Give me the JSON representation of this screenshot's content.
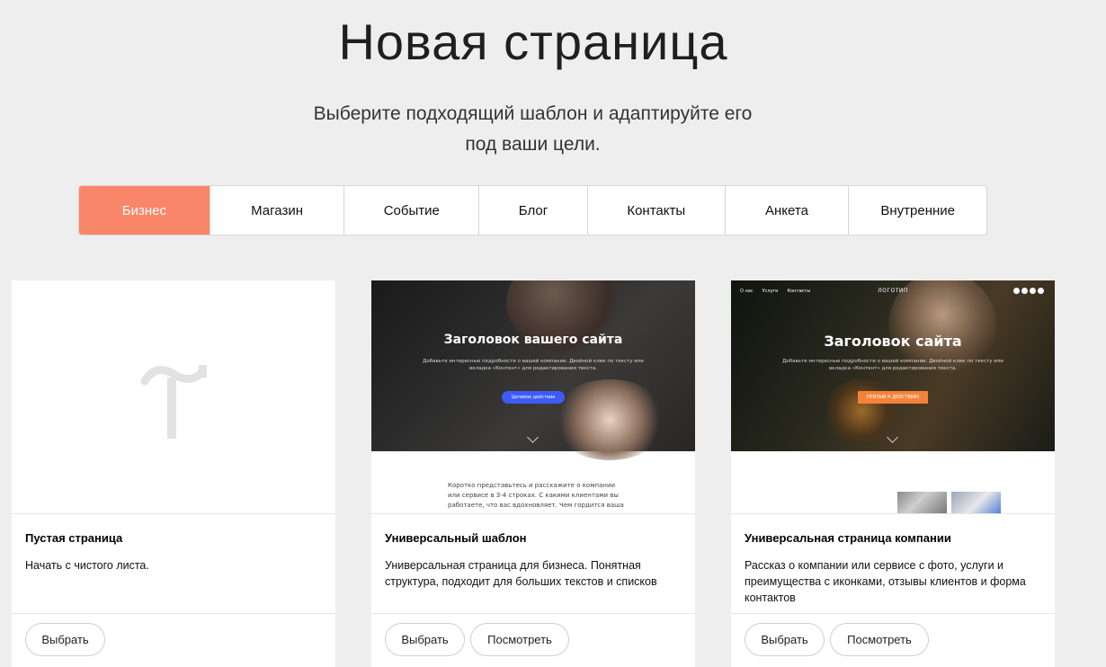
{
  "header": {
    "title": "Новая страница",
    "subtitle": "Выберите подходящий шаблон и адаптируйте его под ваши цели."
  },
  "tabs": [
    {
      "label": "Бизнес",
      "active": true
    },
    {
      "label": "Магазин",
      "active": false
    },
    {
      "label": "Событие",
      "active": false
    },
    {
      "label": "Блог",
      "active": false
    },
    {
      "label": "Контакты",
      "active": false
    },
    {
      "label": "Анкета",
      "active": false
    },
    {
      "label": "Внутренние",
      "active": false
    }
  ],
  "colors": {
    "accent": "#fa8669",
    "blue_button": "#3d5cf5",
    "orange_button": "#f4823a"
  },
  "cards": [
    {
      "title": "Пустая страница",
      "description": "Начать с чистого листа.",
      "select_label": "Выбрать"
    },
    {
      "title": "Универсальный шаблон",
      "description": "Универсальная страница для бизнеса. Понятная структура, подходит для больших текстов и списков",
      "select_label": "Выбрать",
      "view_label": "Посмотреть",
      "preview": {
        "hero_title": "Заголовок вашего сайта",
        "hero_text": "Добавьте интересные подробности о вашей компании. Двойной клик по тексту или вкладка «Контент» для редактирования текста.",
        "hero_button": "Целевое действие",
        "body_text": "Коротко представьтесь и расскажите о компании или сервисе в 3-4 строках. С какими клиентами вы работаете, что вас вдохновляет. Чем гордится ваша команда, какие у нее ценности и мотивация"
      }
    },
    {
      "title": "Универсальная страница компании",
      "description": "Рассказ о компании или сервисе с фото, услуги и преимущества с иконками, отзывы клиентов и форма контактов",
      "select_label": "Выбрать",
      "view_label": "Посмотреть",
      "preview": {
        "nav": [
          "О нас",
          "Услуги",
          "Контакты"
        ],
        "logo": "ЛОГОТИП",
        "hero_title": "Заголовок сайта",
        "hero_text": "Добавьте интересные подробности о вашей компании. Двойной клик по тексту или вкладка «Контент» для редактирования текста.",
        "hero_button": "ПРИЗЫВ К ДЕЙСТВИЮ"
      }
    }
  ]
}
